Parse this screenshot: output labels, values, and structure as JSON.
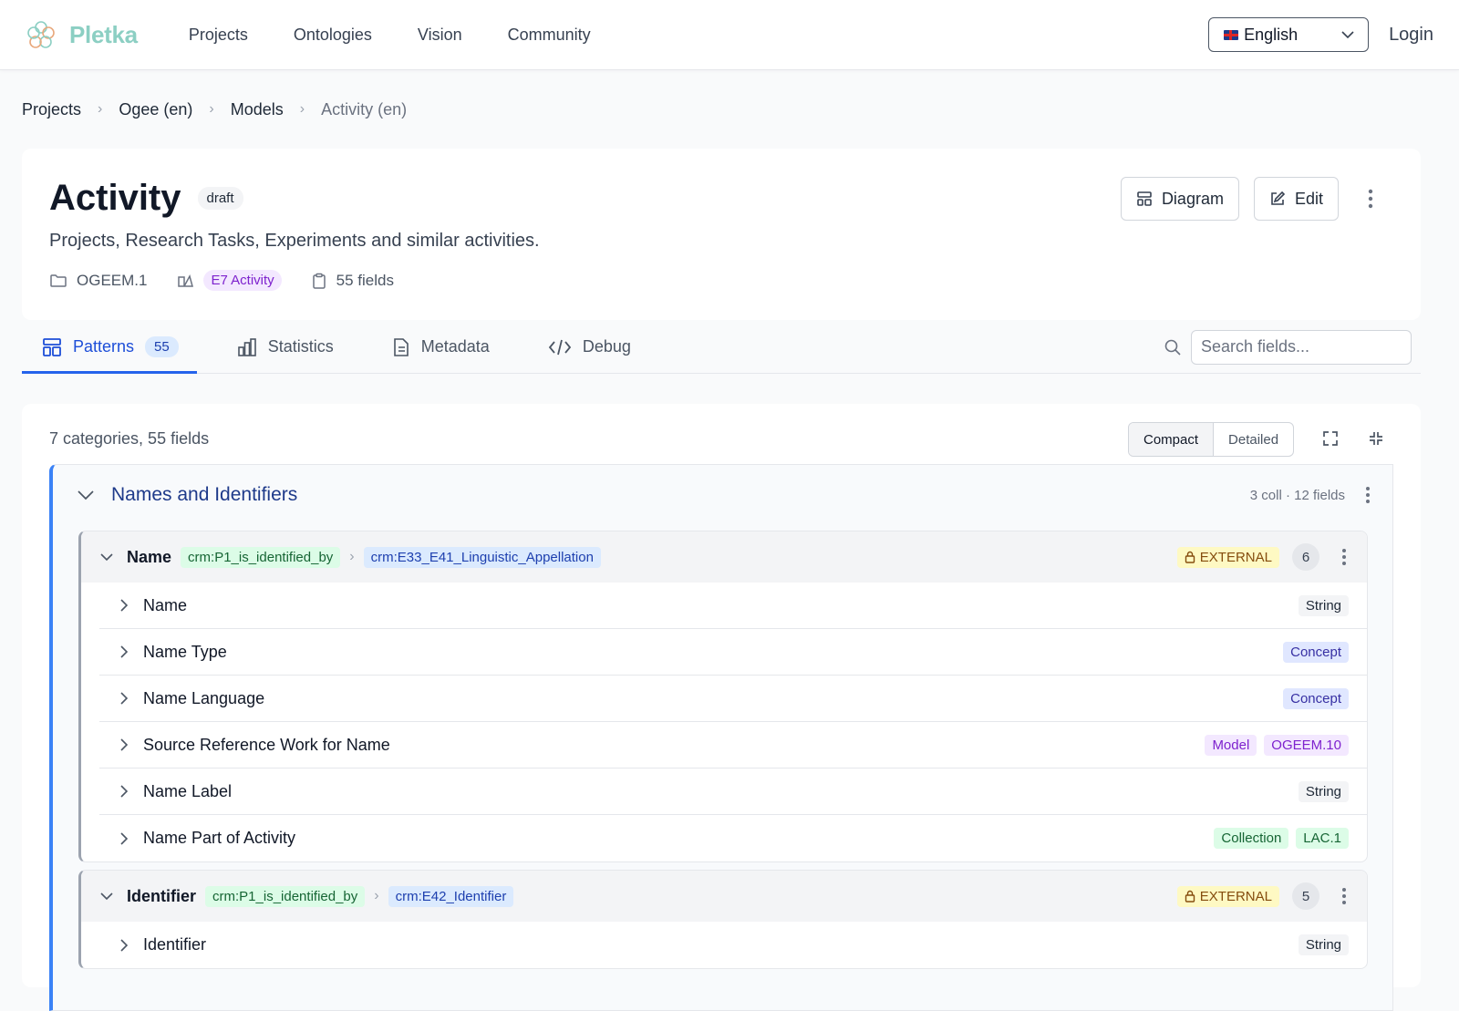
{
  "app": {
    "name": "Pletka"
  },
  "nav": {
    "items": [
      "Projects",
      "Ontologies",
      "Vision",
      "Community"
    ]
  },
  "language": {
    "selected": "English",
    "flag_icon": "uk-flag-icon"
  },
  "login": "Login",
  "breadcrumb": [
    "Projects",
    "Ogee (en)",
    "Models",
    "Activity (en)"
  ],
  "model": {
    "title": "Activity",
    "status": "draft",
    "description": "Projects, Research Tasks, Experiments and similar activities.",
    "id": "OGEEM.1",
    "class": "E7 Activity",
    "fields": "55 fields"
  },
  "actions": {
    "diagram": "Diagram",
    "edit": "Edit"
  },
  "tabs": [
    {
      "label": "Patterns",
      "count": "55",
      "icon": "layout-icon"
    },
    {
      "label": "Statistics",
      "icon": "bar-chart-icon"
    },
    {
      "label": "Metadata",
      "icon": "document-icon"
    },
    {
      "label": "Debug",
      "icon": "code-icon"
    }
  ],
  "search": {
    "placeholder": "Search fields..."
  },
  "content": {
    "summary": "7 categories, 55 fields",
    "view_compact": "Compact",
    "view_detailed": "Detailed"
  },
  "category": {
    "title": "Names and Identifiers",
    "info": "3 coll · 12 fields"
  },
  "groups": [
    {
      "name": "Name",
      "property": "crm:P1_is_identified_by",
      "class": "crm:E33_E41_Linguistic_Appellation",
      "external": "EXTERNAL",
      "count": "6",
      "fields": [
        {
          "name": "Name",
          "types": [
            [
              "String",
              "string"
            ]
          ]
        },
        {
          "name": "Name Type",
          "types": [
            [
              "Concept",
              "concept"
            ]
          ]
        },
        {
          "name": "Name Language",
          "types": [
            [
              "Concept",
              "concept"
            ]
          ]
        },
        {
          "name": "Source Reference Work for Name",
          "types": [
            [
              "Model",
              "model"
            ],
            [
              "OGEEM.10",
              "model"
            ]
          ]
        },
        {
          "name": "Name Label",
          "types": [
            [
              "String",
              "string"
            ]
          ]
        },
        {
          "name": "Name Part of Activity",
          "types": [
            [
              "Collection",
              "collection"
            ],
            [
              "LAC.1",
              "collection"
            ]
          ]
        }
      ]
    },
    {
      "name": "Identifier",
      "property": "crm:P1_is_identified_by",
      "class": "crm:E42_Identifier",
      "external": "EXTERNAL",
      "count": "5",
      "fields": [
        {
          "name": "Identifier",
          "types": [
            [
              "String",
              "string"
            ]
          ]
        }
      ]
    }
  ]
}
